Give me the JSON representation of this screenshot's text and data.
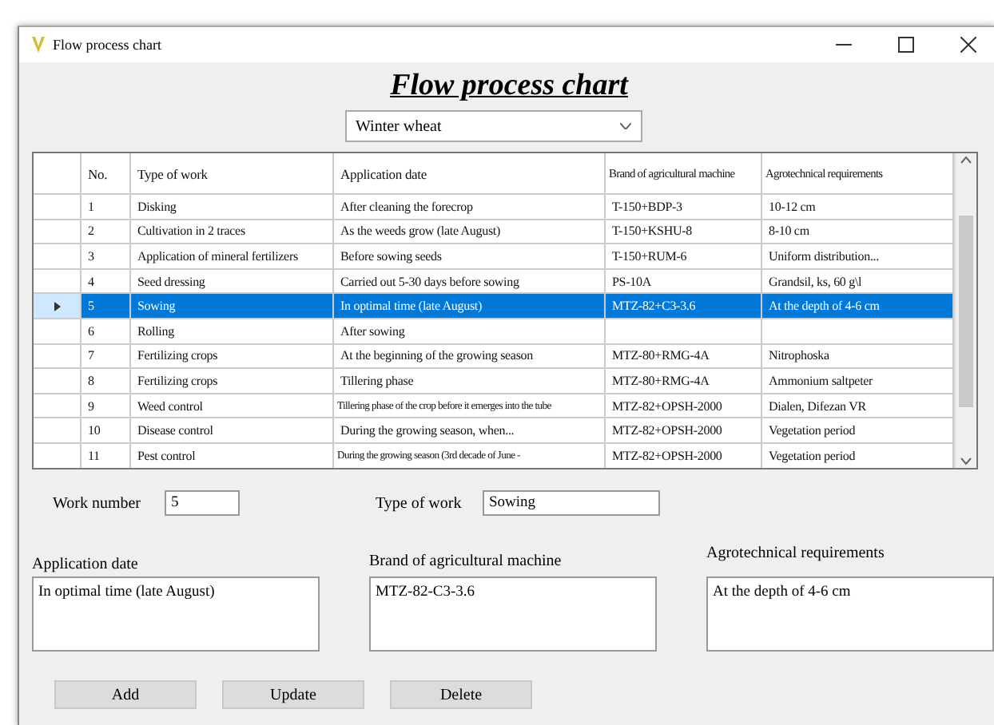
{
  "window": {
    "title": "Flow process chart"
  },
  "heading": "Flow process chart",
  "crop_select": {
    "value": "Winter wheat"
  },
  "table": {
    "columns": [
      "No.",
      "Type of work",
      "Application date",
      "Brand of agricultural machine",
      "Agrotechnical requirements"
    ],
    "rows": [
      {
        "selected": false,
        "cells": [
          "1",
          "Disking",
          "After cleaning the forecrop",
          "T-150+BDP-3",
          "10-12 cm"
        ]
      },
      {
        "selected": false,
        "cells": [
          "2",
          "Cultivation in 2 traces",
          "As the weeds grow (late August)",
          "T-150+KSHU-8",
          "8-10 cm"
        ]
      },
      {
        "selected": false,
        "cells": [
          "3",
          "Application of mineral fertilizers",
          "Before sowing seeds",
          "T-150+RUM-6",
          "Uniform distribution..."
        ]
      },
      {
        "selected": false,
        "cells": [
          "4",
          "Seed dressing",
          "Carried out 5-30 days before sowing",
          "PS-10A",
          "Grandsil, ks, 60 g\\l"
        ]
      },
      {
        "selected": true,
        "cells": [
          "5",
          "Sowing",
          "In optimal time (late August)",
          "MTZ-82+C3-3.6",
          "At the depth of 4-6 cm"
        ]
      },
      {
        "selected": false,
        "cells": [
          "6",
          "Rolling",
          "After sowing"
        ]
      },
      {
        "selected": false,
        "cells": [
          "7",
          "Fertilizing crops",
          "At the beginning of the growing season",
          "MTZ-80+RMG-4A",
          "Nitrophoska"
        ]
      },
      {
        "selected": false,
        "cells": [
          "8",
          "Fertilizing crops",
          "Tillering phase",
          "MTZ-80+RMG-4A",
          "Ammonium saltpeter"
        ]
      },
      {
        "selected": false,
        "cells": [
          "9",
          "Weed control",
          "Tillering phase of the crop before it emerges into the tube",
          "MTZ-82+OPSH-2000",
          "Dialen, Difezan VR"
        ]
      },
      {
        "selected": false,
        "cells": [
          "10",
          "Disease control",
          "During the growing season, when...",
          "MTZ-82+OPSH-2000",
          "Vegetation period"
        ]
      },
      {
        "selected": false,
        "cells": [
          "11",
          "Pest control",
          "During the growing season (3rd decade of June -",
          "MTZ-82+OPSH-2000",
          "Vegetation period"
        ]
      }
    ]
  },
  "form": {
    "work_number": {
      "label": "Work number",
      "value": "5"
    },
    "type_of_work": {
      "label": "Type of work",
      "value": "Sowing"
    },
    "application_date": {
      "label": "Application date",
      "value": "In optimal time (late August)"
    },
    "brand": {
      "label": "Brand of agricultural machine",
      "value": "MTZ-82-C3-3.6"
    },
    "requirements": {
      "label": "Agrotechnical requirements",
      "value": "At the depth of 4-6 cm"
    }
  },
  "buttons": [
    "Add",
    "Update",
    "Delete"
  ]
}
